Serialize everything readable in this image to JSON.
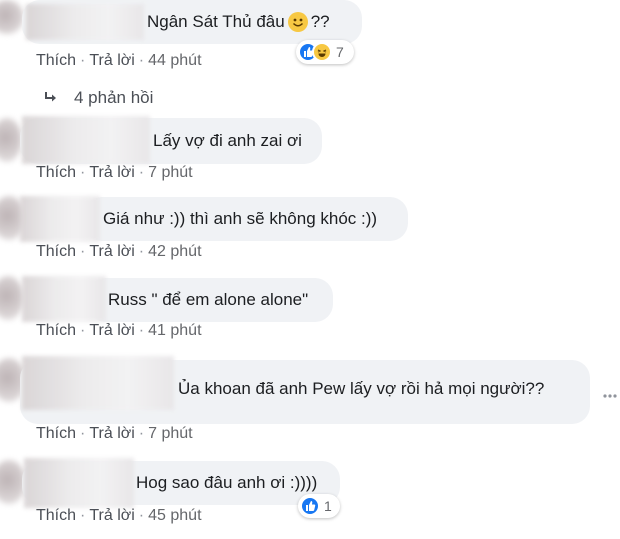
{
  "comments": [
    {
      "text": "Ngân Sát Thủ đâu",
      "text_suffix": "??",
      "time": "44 phút",
      "reaction_count": "7"
    },
    {
      "text": "Lấy vợ đi anh zai ơi",
      "time": "7 phút"
    },
    {
      "text": "Giá như :)) thì anh sẽ không khóc :))",
      "time": "42 phút"
    },
    {
      "text": "Russ \" để em alone alone\"",
      "time": "41 phút"
    },
    {
      "text": "Ủa khoan đã anh Pew lấy vợ rồi hả mọi người??",
      "time": "7 phút"
    },
    {
      "text": "Hog sao đâu anh ơi :))))",
      "time": "45 phút",
      "reaction_count": "1"
    }
  ],
  "actions": {
    "like": "Thích",
    "reply": "Trả lời",
    "separator": "·"
  },
  "replies": {
    "label": "4 phản hồi"
  },
  "colors": {
    "bubble": "#f0f2f5",
    "meta": "#65676b",
    "like_blue": "#1877f2"
  },
  "icons": {
    "reply_arrow": "reply-arrow-icon",
    "like": "like-icon",
    "haha": "haha-icon",
    "smile": "smile-emoji-icon",
    "more": "more-options-icon"
  }
}
